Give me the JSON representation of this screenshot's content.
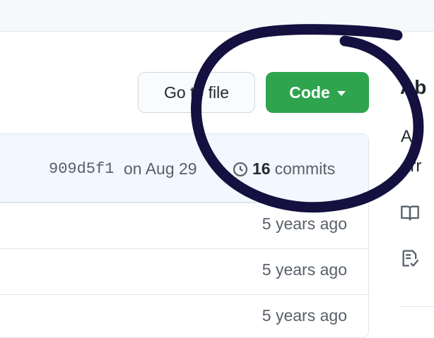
{
  "header": {
    "go_to_file_label": "Go to file",
    "code_label": "Code"
  },
  "commit_bar": {
    "sha": "909d5f1",
    "date_text": "on Aug 29",
    "commit_count": "16",
    "commit_label": "commits"
  },
  "file_rows": [
    {
      "age": "5 years ago"
    },
    {
      "age": "5 years ago"
    },
    {
      "age": "5 years ago"
    }
  ],
  "sidebar": {
    "title": "Ab",
    "desc_line1": "A",
    "desc_line2": "arr",
    "icons": [
      "book-icon",
      "law-icon"
    ]
  },
  "colors": {
    "code_button": "#2ea44f",
    "annotation_ink": "#14103f"
  }
}
